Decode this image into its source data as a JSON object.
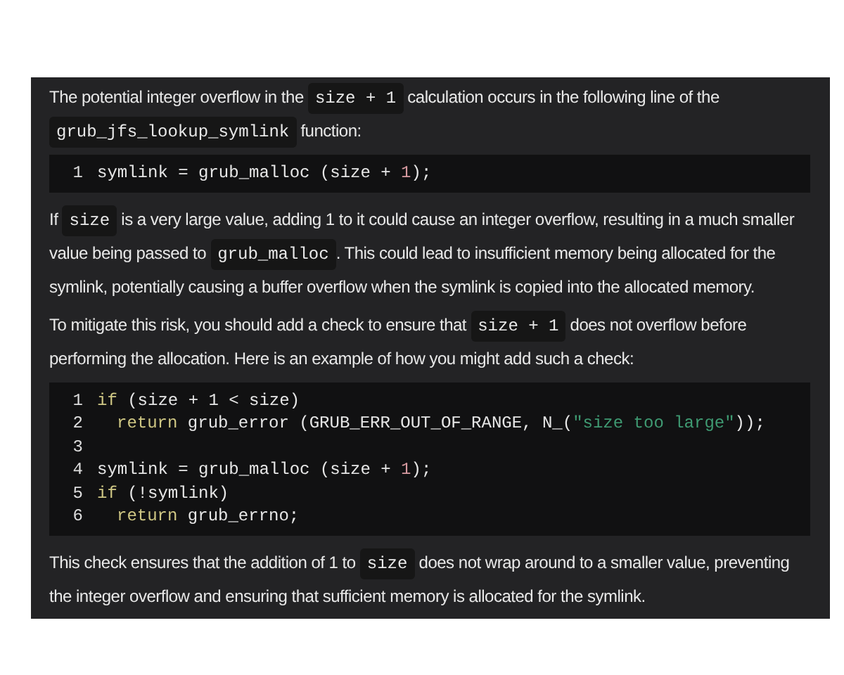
{
  "blocks": [
    {
      "kind": "paragraph",
      "segments": [
        {
          "kind": "text",
          "text": "The potential integer overflow in the "
        },
        {
          "kind": "code",
          "text": "size + 1"
        },
        {
          "kind": "text",
          "text": " calculation occurs in the following line of the "
        },
        {
          "kind": "code",
          "text": "grub_jfs_lookup_symlink"
        },
        {
          "kind": "text",
          "text": " function:"
        }
      ]
    },
    {
      "kind": "code",
      "lines": [
        {
          "number": "1",
          "tokens": [
            {
              "kind": "plain",
              "text": "symlink = grub_malloc (size + "
            },
            {
              "kind": "number",
              "text": "1"
            },
            {
              "kind": "plain",
              "text": ");"
            }
          ]
        }
      ]
    },
    {
      "kind": "paragraph",
      "segments": [
        {
          "kind": "text",
          "text": "If "
        },
        {
          "kind": "code",
          "text": "size"
        },
        {
          "kind": "text",
          "text": " is a very large value, adding 1 to it could cause an integer overflow, resulting in a much smaller value being passed to "
        },
        {
          "kind": "code",
          "text": "grub_malloc"
        },
        {
          "kind": "text",
          "text": ". This could lead to insufficient memory being allocated for the symlink, potentially causing a buffer overflow when the symlink is copied into the allocated memory."
        }
      ]
    },
    {
      "kind": "paragraph",
      "segments": [
        {
          "kind": "text",
          "text": "To mitigate this risk, you should add a check to ensure that "
        },
        {
          "kind": "code",
          "text": "size + 1"
        },
        {
          "kind": "text",
          "text": " does not overflow before performing the allocation. Here is an example of how you might add such a check:"
        }
      ]
    },
    {
      "kind": "code",
      "lines": [
        {
          "number": "1",
          "tokens": [
            {
              "kind": "keyword",
              "text": "if"
            },
            {
              "kind": "plain",
              "text": " (size + 1 < size)"
            }
          ]
        },
        {
          "number": "2",
          "indent": true,
          "tokens": [
            {
              "kind": "keyword",
              "text": "return"
            },
            {
              "kind": "plain",
              "text": " grub_error (GRUB_ERR_OUT_OF_RANGE, N_("
            },
            {
              "kind": "string",
              "text": "\"size too large\""
            },
            {
              "kind": "plain",
              "text": "));"
            }
          ]
        },
        {
          "number": "3"
        },
        {
          "number": "4",
          "tokens": [
            {
              "kind": "plain",
              "text": "symlink = grub_malloc (size + "
            },
            {
              "kind": "number",
              "text": "1"
            },
            {
              "kind": "plain",
              "text": ");"
            }
          ]
        },
        {
          "number": "5",
          "tokens": [
            {
              "kind": "keyword",
              "text": "if"
            },
            {
              "kind": "plain",
              "text": " (!symlink)"
            }
          ]
        },
        {
          "number": "6",
          "indent": true,
          "tokens": [
            {
              "kind": "keyword",
              "text": "return"
            },
            {
              "kind": "plain",
              "text": " grub_errno;"
            }
          ]
        }
      ]
    },
    {
      "kind": "paragraph",
      "segments": [
        {
          "kind": "text",
          "text": "This check ensures that the addition of 1 to "
        },
        {
          "kind": "code",
          "text": "size"
        },
        {
          "kind": "text",
          "text": " does not wrap around to a smaller value, preventing the integer overflow and ensuring that sufficient memory is allocated for the symlink."
        }
      ]
    }
  ]
}
